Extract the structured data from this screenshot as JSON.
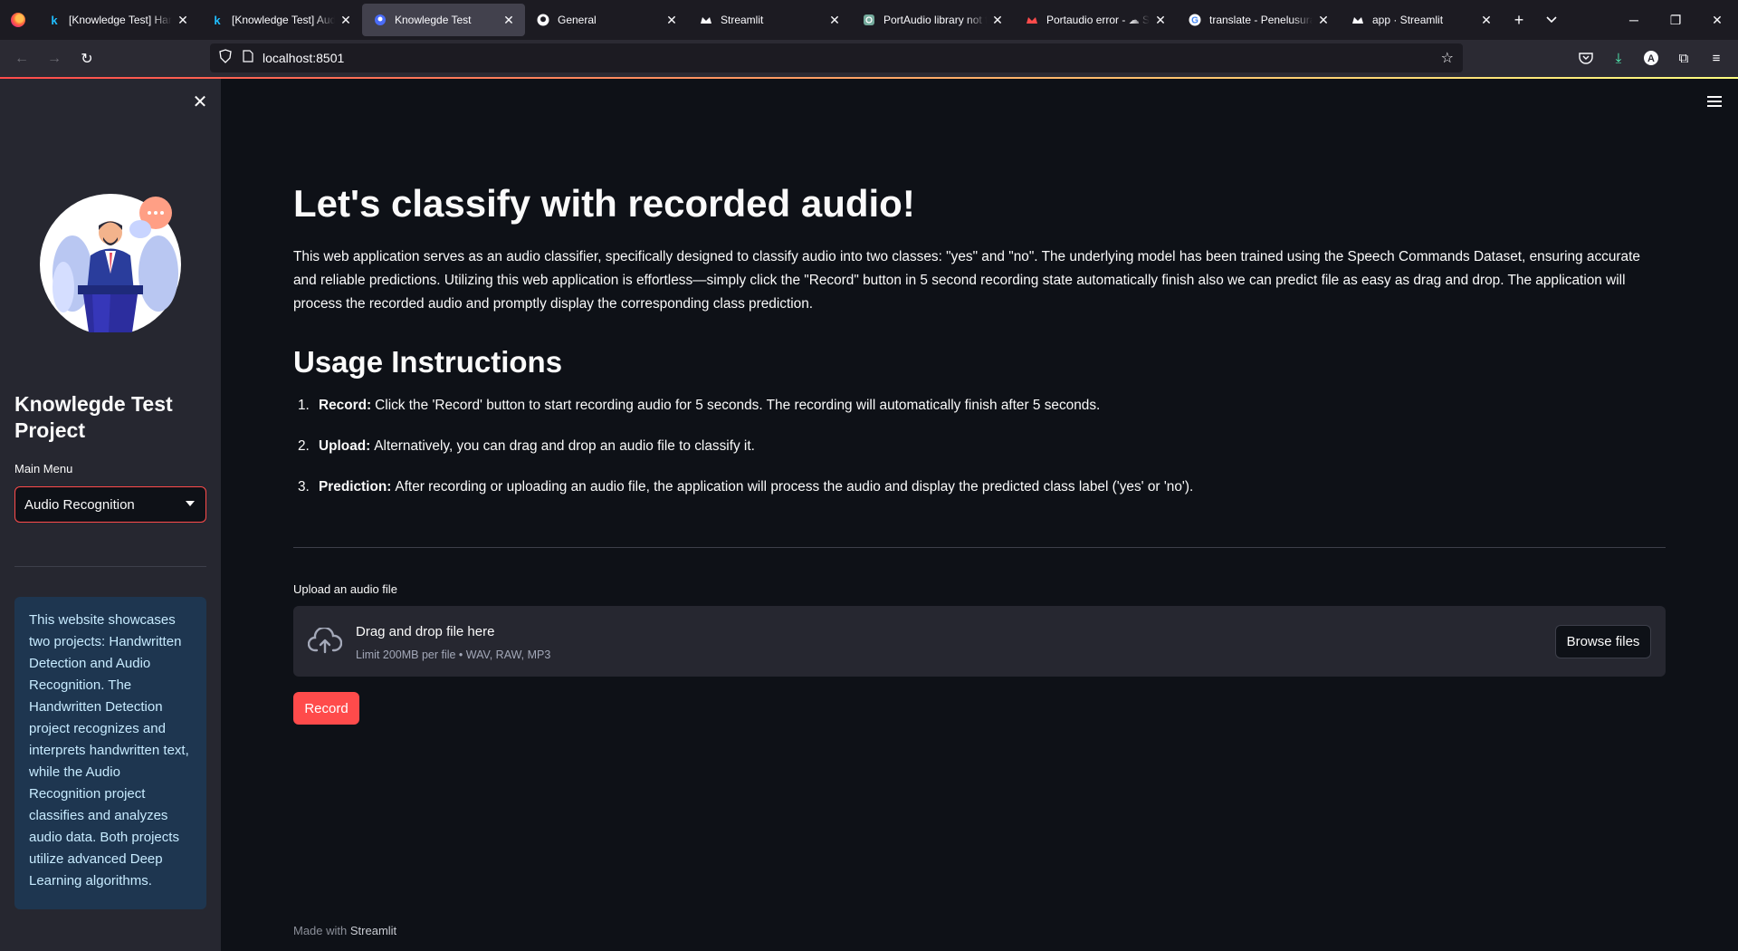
{
  "browser": {
    "tabs": [
      {
        "label": "[Knowledge Test] Hand",
        "icon": "k",
        "active": false
      },
      {
        "label": "[Knowledge Test] Audi",
        "icon": "k",
        "active": false
      },
      {
        "label": "Knowlegde Test",
        "icon": "streamlit",
        "active": true
      },
      {
        "label": "General",
        "icon": "github",
        "active": false
      },
      {
        "label": "Streamlit",
        "icon": "streamlit-crown",
        "active": false
      },
      {
        "label": "PortAudio library not fo",
        "icon": "openai",
        "active": false
      },
      {
        "label": "Portaudio error - ☁ St",
        "icon": "streamlit-red",
        "active": false
      },
      {
        "label": "translate - Penelusuran",
        "icon": "google",
        "active": false
      },
      {
        "label": "app · Streamlit",
        "icon": "streamlit-crown",
        "active": false
      }
    ],
    "url": "localhost:8501"
  },
  "sidebar": {
    "title": "Knowlegde Test Project",
    "menu_label": "Main Menu",
    "selected": "Audio Recognition",
    "info": "This website showcases two projects: Handwritten Detection and Audio Recognition. The Handwritten Detection project recognizes and interprets handwritten text, while the Audio Recognition project classifies and analyzes audio data. Both projects utilize advanced Deep Learning algorithms."
  },
  "main": {
    "title": "Let's classify with recorded audio!",
    "intro": "This web application serves as an audio classifier, specifically designed to classify audio into two classes: \"yes\" and \"no\". The underlying model has been trained using the Speech Commands Dataset, ensuring accurate and reliable predictions. Utilizing this web application is effortless—simply click the \"Record\" button in 5 second recording state automatically finish also we can predict file as easy as drag and drop. The application will process the recorded audio and promptly display the corresponding class prediction.",
    "usage_title": "Usage Instructions",
    "steps": [
      {
        "num": "1.",
        "bold": "Record:",
        "text": "Click the 'Record' button to start recording audio for 5 seconds. The recording will automatically finish after 5 seconds."
      },
      {
        "num": "2.",
        "bold": "Upload:",
        "text": "Alternatively, you can drag and drop an audio file to classify it."
      },
      {
        "num": "3.",
        "bold": "Prediction:",
        "text": "After recording or uploading an audio file, the application will process the audio and display the predicted class label ('yes' or 'no')."
      }
    ],
    "upload_label": "Upload an audio file",
    "dropzone_main": "Drag and drop file here",
    "dropzone_sub": "Limit 200MB per file • WAV, RAW, MP3",
    "browse_label": "Browse files",
    "record_label": "Record",
    "footer_prefix": "Made with",
    "footer_brand": "Streamlit"
  },
  "colors": {
    "accent": "#ff4b4b",
    "background": "#0e1117",
    "sidebar": "#262730",
    "info_bg": "#1e3650",
    "info_text": "#c7ebff"
  }
}
